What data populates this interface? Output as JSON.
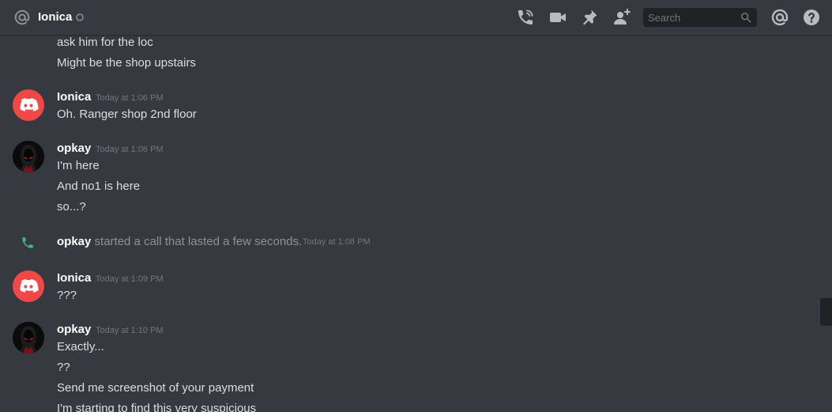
{
  "header": {
    "at_icon": "at-sign-icon",
    "title": "Ionica",
    "status": "offline",
    "icons": [
      "start-voice-call-icon",
      "start-video-call-icon",
      "pinned-messages-icon",
      "add-friend-icon",
      "mentions-icon",
      "help-icon"
    ],
    "search": {
      "placeholder": "Search",
      "value": ""
    }
  },
  "messages": [
    {
      "type": "continuation",
      "lines": [
        "ask him for the loc",
        "Might be the shop upstairs"
      ]
    },
    {
      "type": "group",
      "author": "Ionica",
      "timestamp": "Today at 1:06 PM",
      "avatar": "discord-default-avatar",
      "lines": [
        "Oh. Ranger shop 2nd floor"
      ]
    },
    {
      "type": "group",
      "author": "opkay",
      "timestamp": "Today at 1:06 PM",
      "avatar": "hooded-figure-avatar",
      "lines": [
        "I'm here",
        "And no1 is here",
        "so...?"
      ]
    },
    {
      "type": "call",
      "author": "opkay",
      "text": "started a call that lasted a few seconds.",
      "timestamp": "Today at 1:08 PM",
      "icon": "phone-icon"
    },
    {
      "type": "group",
      "author": "Ionica",
      "timestamp": "Today at 1:09 PM",
      "avatar": "discord-default-avatar",
      "lines": [
        "???"
      ]
    },
    {
      "type": "group",
      "author": "opkay",
      "timestamp": "Today at 1:10 PM",
      "avatar": "hooded-figure-avatar",
      "lines": [
        "Exactly...",
        "??",
        "Send me screenshot of your payment",
        "I'm starting to find this very suspicious"
      ]
    }
  ],
  "colors": {
    "background": "#36393f",
    "header_text": "#ffffff",
    "message_text": "#dcddde",
    "timestamp": "#72767d",
    "discord_avatar": "#f04747",
    "call_icon": "#43b581",
    "search_bg": "#202225"
  }
}
